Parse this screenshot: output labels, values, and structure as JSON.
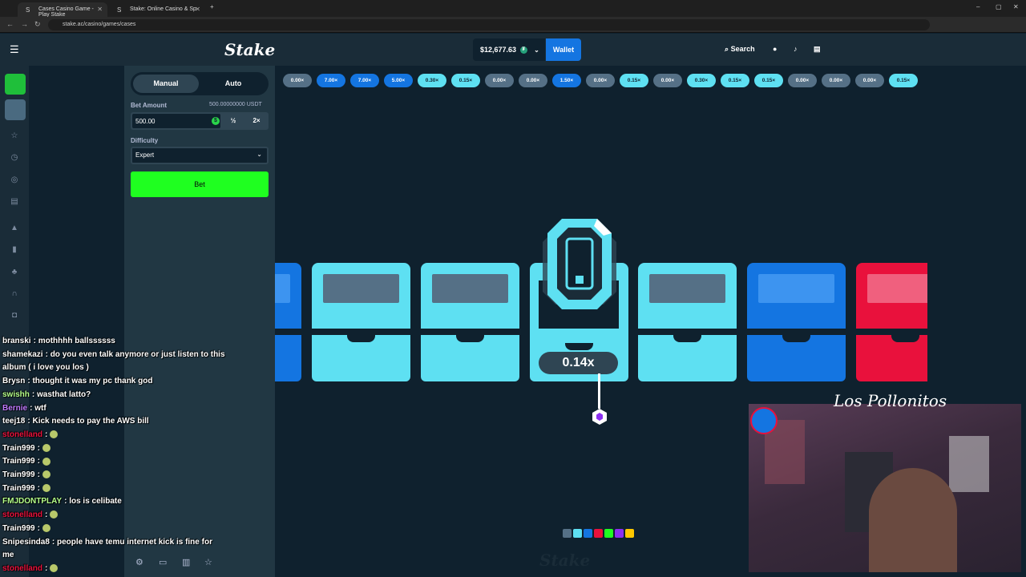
{
  "browser": {
    "tabs": [
      {
        "label": "Cases Casino Game - Play Stake",
        "active": true
      },
      {
        "label": "Stake: Online Casino & Sp",
        "active": false
      }
    ],
    "url": "stake.ac/casino/games/cases"
  },
  "header": {
    "logo": "Stake",
    "balance": "$12,677.63",
    "currency_badge": "₮",
    "wallet_label": "Wallet",
    "search_label": "Search"
  },
  "panel": {
    "modes": [
      "Manual",
      "Auto"
    ],
    "active_mode": "Manual",
    "bet_amount_label": "Bet Amount",
    "bet_amount_usdt": "500.00000000 USDT",
    "bet_value": "500.00",
    "half_label": "½",
    "double_label": "2×",
    "difficulty_label": "Difficulty",
    "difficulty_value": "Expert",
    "bet_button": "Bet"
  },
  "history": [
    {
      "value": "0.00×",
      "color": "#557086",
      "text": "#fff"
    },
    {
      "value": "7.00×",
      "color": "#1475e1",
      "text": "#fff"
    },
    {
      "value": "7.00×",
      "color": "#1475e1",
      "text": "#fff"
    },
    {
      "value": "5.00×",
      "color": "#1475e1",
      "text": "#fff"
    },
    {
      "value": "0.30×",
      "color": "#5ee0f2",
      "text": "#0f212e"
    },
    {
      "value": "0.15×",
      "color": "#5ee0f2",
      "text": "#0f212e"
    },
    {
      "value": "0.00×",
      "color": "#557086",
      "text": "#fff"
    },
    {
      "value": "0.00×",
      "color": "#557086",
      "text": "#fff"
    },
    {
      "value": "1.50×",
      "color": "#1475e1",
      "text": "#fff"
    },
    {
      "value": "0.00×",
      "color": "#557086",
      "text": "#fff"
    },
    {
      "value": "0.15×",
      "color": "#5ee0f2",
      "text": "#0f212e"
    },
    {
      "value": "0.00×",
      "color": "#557086",
      "text": "#fff"
    },
    {
      "value": "0.30×",
      "color": "#5ee0f2",
      "text": "#0f212e"
    },
    {
      "value": "0.15×",
      "color": "#5ee0f2",
      "text": "#0f212e"
    },
    {
      "value": "0.15×",
      "color": "#5ee0f2",
      "text": "#0f212e"
    },
    {
      "value": "0.00×",
      "color": "#557086",
      "text": "#fff"
    },
    {
      "value": "0.00×",
      "color": "#557086",
      "text": "#fff"
    },
    {
      "value": "0.00×",
      "color": "#557086",
      "text": "#fff"
    },
    {
      "value": "0.15×",
      "color": "#5ee0f2",
      "text": "#0f212e"
    }
  ],
  "game": {
    "result_multiplier": "0.14x",
    "chest_colors": {
      "cyan": "#5ee0f2",
      "blue": "#1475e1",
      "red": "#e9113c"
    },
    "swatch_colors": [
      "#557086",
      "#5ee0f2",
      "#1475e1",
      "#e9113c",
      "#1fff20",
      "#8b2ff0",
      "#ffc800"
    ],
    "watermark": "Stake"
  },
  "chat": [
    {
      "user": "branski",
      "color": "#ffffff",
      "msg": "mothhhh ballssssss"
    },
    {
      "user": "shamekazi",
      "color": "#ffffff",
      "msg": "do you even talk anymore or just listen to this"
    },
    {
      "user": "",
      "color": "#ffffff",
      "msg": "album ( i love you los )"
    },
    {
      "user": "Brysn",
      "color": "#ffffff",
      "msg": "thought it was my pc thank god"
    },
    {
      "user": "swishh",
      "color": "#b5ff8a",
      "msg": "wasthat latto?"
    },
    {
      "user": "Bernie",
      "color": "#c07bff",
      "msg": "wtf"
    },
    {
      "user": "teej18",
      "color": "#ffffff",
      "msg": "Kick needs to pay the AWS bill"
    },
    {
      "user": "stonelland",
      "color": "#e9113c",
      "msg": ""
    },
    {
      "user": "Train999",
      "color": "#ffffff",
      "msg": ""
    },
    {
      "user": "Train999",
      "color": "#ffffff",
      "msg": ""
    },
    {
      "user": "Train999",
      "color": "#ffffff",
      "msg": ""
    },
    {
      "user": "Train999",
      "color": "#ffffff",
      "msg": ""
    },
    {
      "user": "FMJDONTPLAY",
      "color": "#b5ff8a",
      "msg": "los is celibate"
    },
    {
      "user": "stonelland",
      "color": "#e9113c",
      "msg": ""
    },
    {
      "user": "Train999",
      "color": "#ffffff",
      "msg": ""
    },
    {
      "user": "Snipesinda8",
      "color": "#ffffff",
      "msg": "people have temu internet kick is fine for"
    },
    {
      "user": "",
      "color": "#ffffff",
      "msg": "me"
    },
    {
      "user": "stonelland",
      "color": "#e9113c",
      "msg": ""
    }
  ],
  "webcam": {
    "signature": "Los Pollonitos"
  }
}
